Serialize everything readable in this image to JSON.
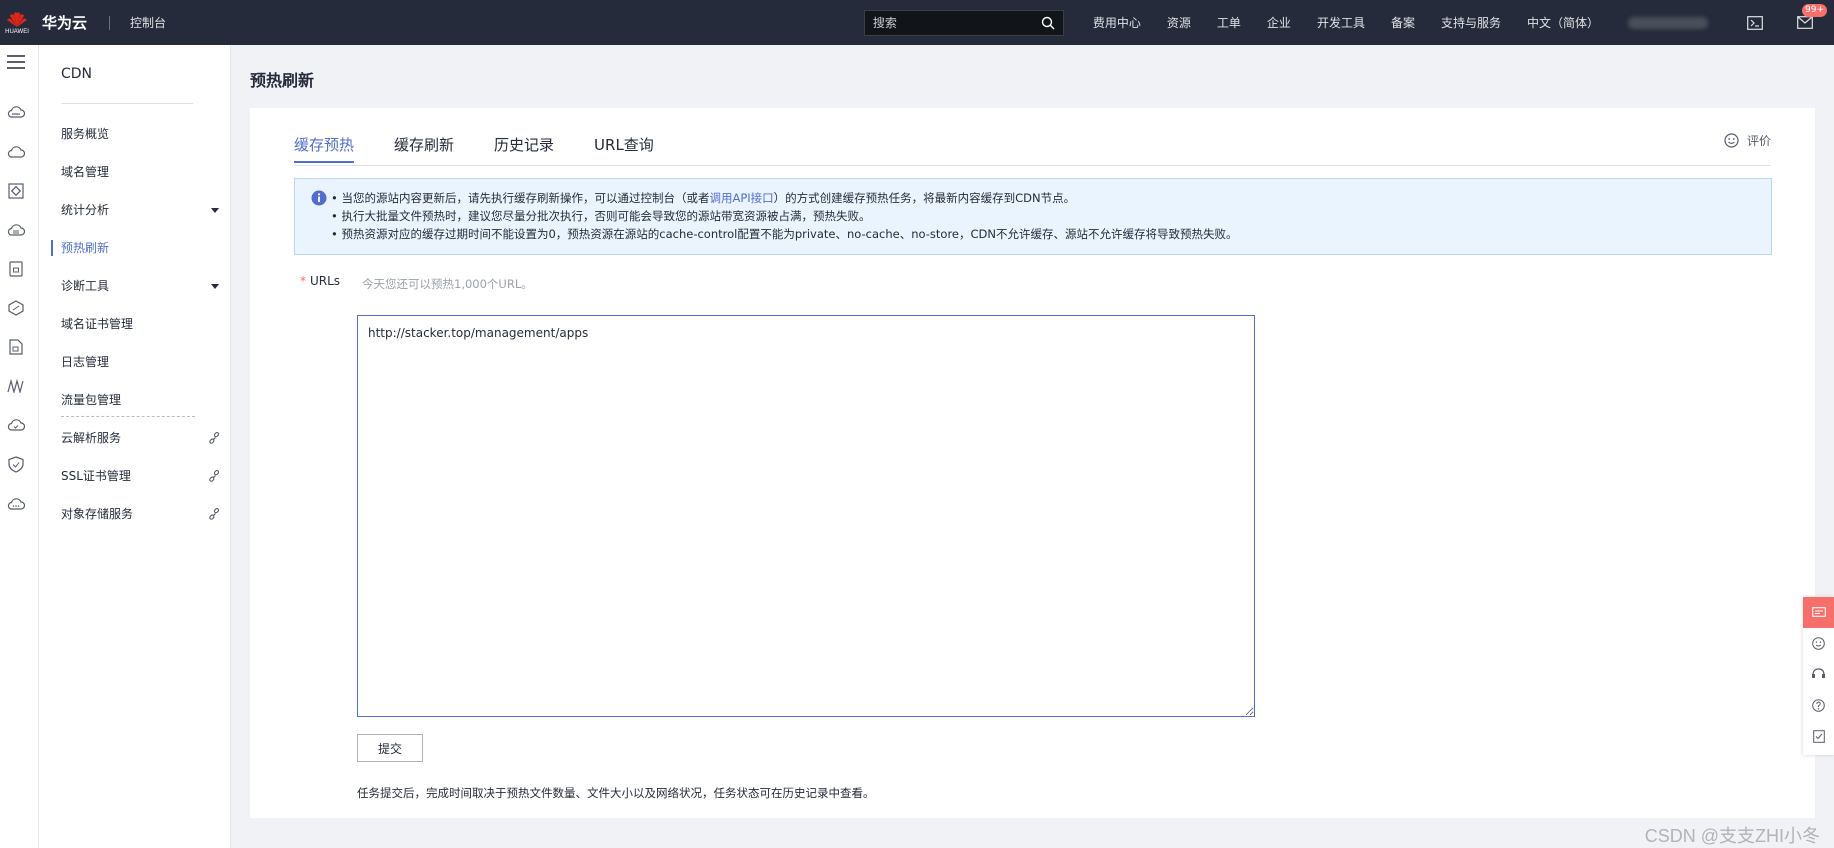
{
  "header": {
    "logo_text": "HUAWEI",
    "brand": "华为云",
    "console": "控制台",
    "search_placeholder": "搜索",
    "nav": [
      "费用中心",
      "资源",
      "工单",
      "企业",
      "开发工具",
      "备案",
      "支持与服务",
      "中文（简体）"
    ],
    "mail_badge": "99+"
  },
  "rail": {
    "icons": [
      "cloud-icon",
      "cloud-outline-icon",
      "diamond-node-icon",
      "cloud-db-icon",
      "document-lock-icon",
      "hexagon-icon",
      "document-icon",
      "waveform-icon",
      "cloud-check-icon",
      "shield-icon",
      "cloud-dots-icon"
    ]
  },
  "sidebar": {
    "title": "CDN",
    "items": [
      {
        "label": "服务概览"
      },
      {
        "label": "域名管理"
      },
      {
        "label": "统计分析"
      },
      {
        "label": "预热刷新"
      },
      {
        "label": "诊断工具"
      },
      {
        "label": "域名证书管理"
      },
      {
        "label": "日志管理"
      },
      {
        "label": "流量包管理"
      },
      {
        "label": "云解析服务"
      },
      {
        "label": "SSL证书管理"
      },
      {
        "label": "对象存储服务"
      }
    ]
  },
  "main": {
    "page_title": "预热刷新",
    "tabs": [
      {
        "label": "缓存预热"
      },
      {
        "label": "缓存刷新"
      },
      {
        "label": "历史记录"
      },
      {
        "label": "URL查询"
      }
    ],
    "rate_label": "评价",
    "info": {
      "line1_prefix": "当您的源站内容更新后，请先执行缓存刷新操作，可以通过控制台（或者",
      "line1_link": "调用API接口",
      "line1_suffix": "）的方式创建缓存预热任务，将最新内容缓存到CDN节点。",
      "line2": "执行大批量文件预热时，建议您尽量分批次执行，否则可能会导致您的源站带宽资源被占满，预热失败。",
      "line3": "预热资源对应的缓存过期时间不能设置为0，预热资源在源站的cache-control配置不能为private、no-cache、no-store，CDN不允许缓存、源站不允许缓存将导致预热失败。"
    },
    "urls_required": "*",
    "urls_label": "URLs",
    "urls_hint": "今天您还可以预热1,000个URL。",
    "urls_value": "http://stacker.top/management/apps",
    "submit_label": "提交",
    "note": "任务提交后，完成时间取决于预热文件数量、文件大小以及网络状况，任务状态可在历史记录中查看。"
  },
  "watermark": "CSDN @支支ZHI小冬",
  "colors": {
    "topbar": "#252b3a",
    "accent": "#526ecc",
    "info_bg": "#eaf4fe",
    "required": "#f66f6a"
  }
}
